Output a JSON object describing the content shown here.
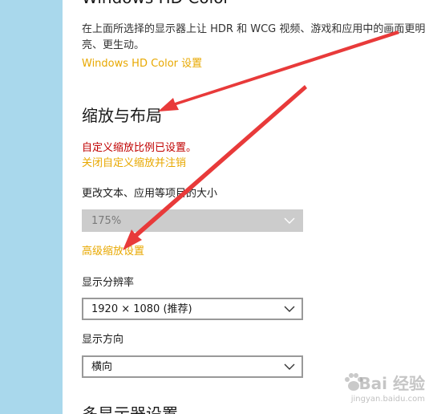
{
  "hdr": {
    "heading_fragment": "Windows HD Color",
    "description": "在上面所选择的显示器上让 HDR 和 WCG 视频、游戏和应用中的画面更明亮、更生动。",
    "settings_link": "Windows HD Color 设置"
  },
  "scale_layout": {
    "title": "缩放与布局",
    "custom_warning": "自定义缩放比例已设置。",
    "disable_link": "关闭自定义缩放并注销",
    "size_label": "更改文本、应用等项目的大小",
    "size_value": "175%",
    "advanced_link": "高级缩放设置",
    "resolution_label": "显示分辨率",
    "resolution_value": "1920 × 1080 (推荐)",
    "orientation_label": "显示方向",
    "orientation_value": "横向"
  },
  "multi_display": {
    "heading_fragment": "多显示器设置"
  },
  "watermark": {
    "logo": "Bai 经验",
    "url": "jingyan.baidu.com"
  },
  "colors": {
    "sidebar": "#a9d8ec",
    "link": "#e8a800",
    "warning": "#c00000",
    "arrow": "#e83a3a"
  },
  "icons": {
    "dropdown": "chevron-down-icon",
    "annotation": "red-arrow-annotation",
    "watermark": "baidu-paw-icon"
  }
}
